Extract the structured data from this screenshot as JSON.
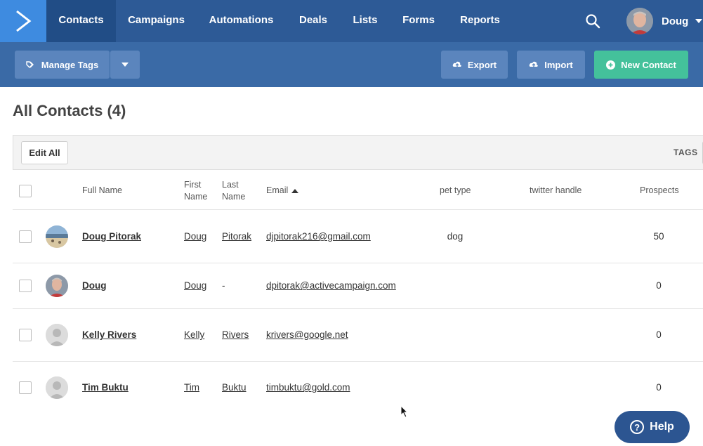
{
  "nav": {
    "items": [
      {
        "label": "Contacts",
        "active": true
      },
      {
        "label": "Campaigns",
        "active": false
      },
      {
        "label": "Automations",
        "active": false
      },
      {
        "label": "Deals",
        "active": false
      },
      {
        "label": "Lists",
        "active": false
      },
      {
        "label": "Forms",
        "active": false
      },
      {
        "label": "Reports",
        "active": false
      }
    ],
    "search_icon": "search-icon",
    "user_name": "Doug"
  },
  "toolbar": {
    "manage_tags_label": "Manage Tags",
    "export_label": "Export",
    "import_label": "Import",
    "new_contact_label": "New Contact"
  },
  "page": {
    "title": "All Contacts (4)",
    "edit_all_label": "Edit All",
    "tags_label": "TAGS"
  },
  "table": {
    "headers": {
      "full_name": "Full Name",
      "first_name_line1": "First",
      "first_name_line2": "Name",
      "last_name_line1": "Last",
      "last_name_line2": "Name",
      "email": "Email",
      "pet_type": "pet type",
      "twitter_handle": "twitter handle",
      "prospects": "Prospects"
    },
    "rows": [
      {
        "full_name": "Doug Pitorak",
        "first": "Doug",
        "last": "Pitorak",
        "email": "djpitorak216@gmail.com",
        "pet_type": "dog",
        "twitter": "",
        "prospects": "50",
        "avatar": "landscape"
      },
      {
        "full_name": "Doug",
        "first": "Doug",
        "last": "-",
        "email": "dpitorak@activecampaign.com",
        "pet_type": "",
        "twitter": "",
        "prospects": "0",
        "avatar": "photo"
      },
      {
        "full_name": "Kelly Rivers",
        "first": "Kelly",
        "last": "Rivers",
        "email": "krivers@google.net",
        "pet_type": "",
        "twitter": "",
        "prospects": "0",
        "avatar": "default"
      },
      {
        "full_name": "Tim Buktu",
        "first": "Tim",
        "last": "Buktu",
        "email": "timbuktu@gold.com",
        "pet_type": "",
        "twitter": "",
        "prospects": "0",
        "avatar": "default"
      }
    ]
  },
  "help": {
    "label": "Help"
  },
  "colors": {
    "nav_bg": "#2d5a96",
    "toolbar_bg": "#3a6aa6",
    "accent_green": "#44c19b",
    "logo_bg": "#3e8be0"
  }
}
